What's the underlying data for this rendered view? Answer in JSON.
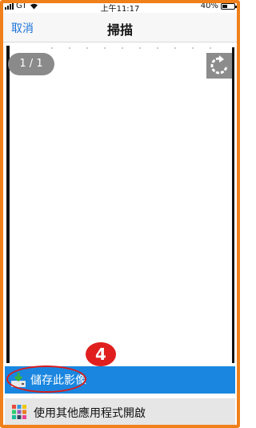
{
  "status_bar": {
    "carrier": "GT",
    "time": "上午11:17",
    "battery": "40%"
  },
  "navbar": {
    "cancel_label": "取消",
    "title": "掃描"
  },
  "preview": {
    "page_indicator": "1 / 1"
  },
  "annotation": {
    "step_number": "4"
  },
  "actions": {
    "save_label": "儲存此影像",
    "open_with_label": "使用其他應用程式開啟"
  },
  "icons": [
    "signal-icon",
    "wifi-icon",
    "battery-icon",
    "rotate-icon",
    "save-download-icon",
    "apps-grid-icon"
  ],
  "colors": {
    "accent": "#1a86e0",
    "link": "#1a73d9",
    "annotation": "#e01e1e",
    "frame": "#f0801a"
  }
}
